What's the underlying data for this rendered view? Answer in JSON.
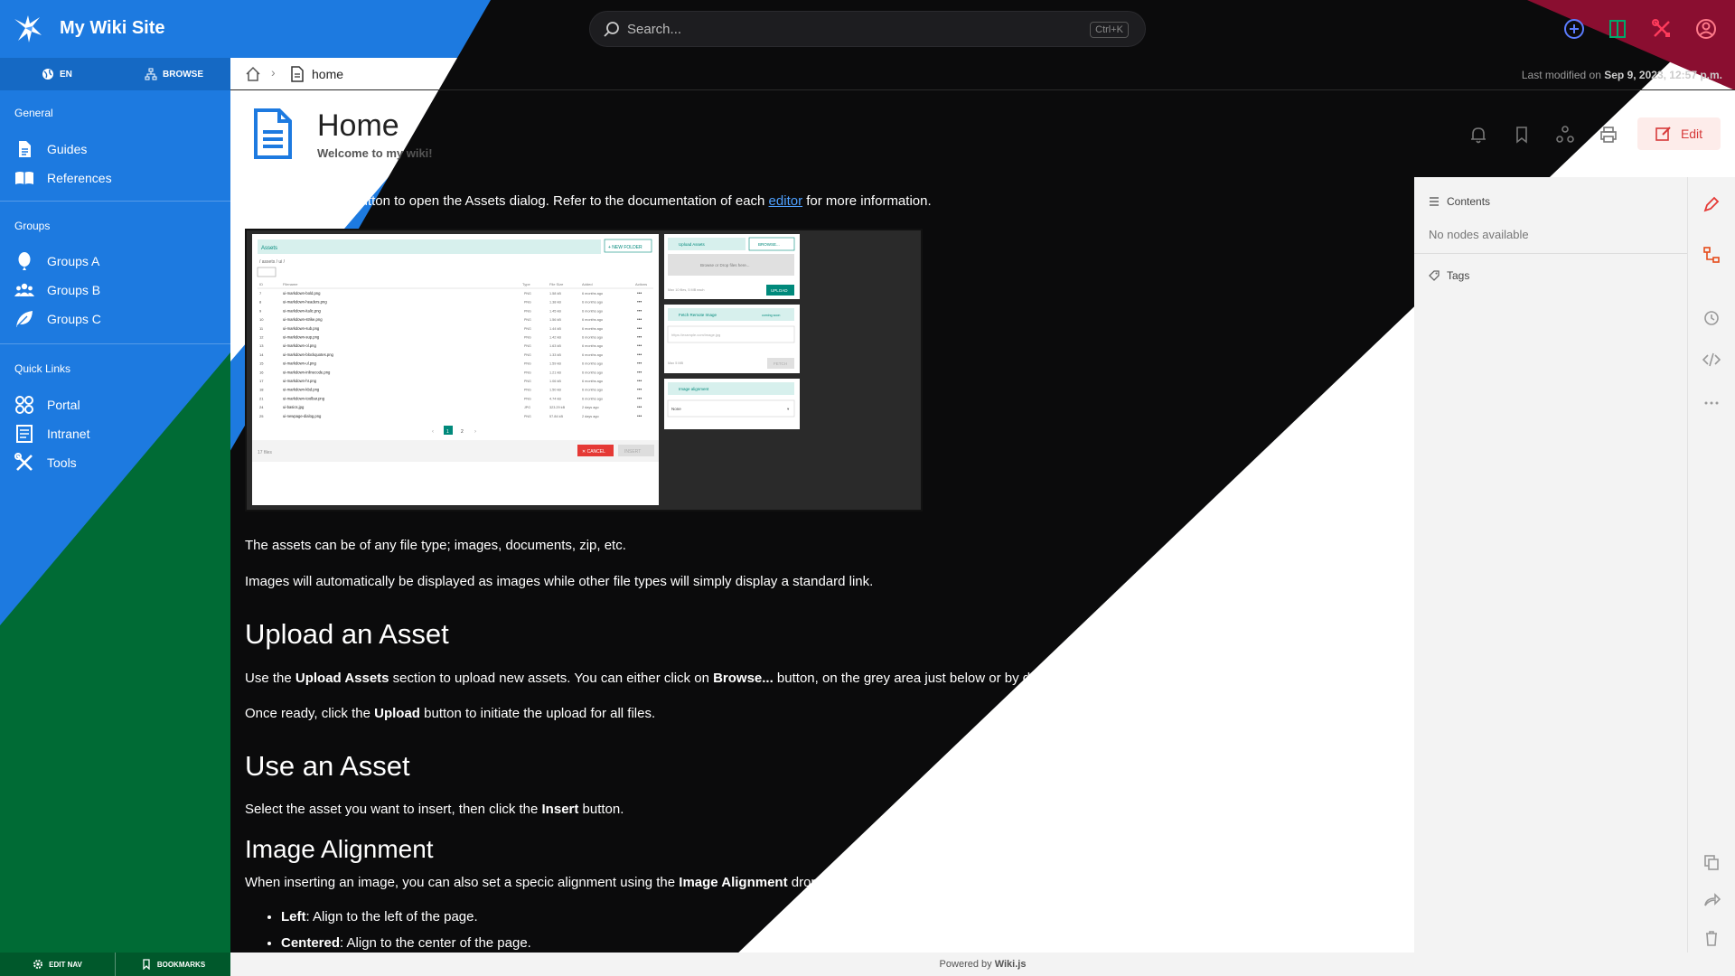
{
  "header": {
    "site_title": "My Wiki Site",
    "search_placeholder": "Search...",
    "search_shortcut": "Ctrl+K",
    "icons": [
      "new-page-icon",
      "browse-icon",
      "admin-icon",
      "account-icon"
    ]
  },
  "sidebar": {
    "tabs": [
      {
        "label": "EN",
        "icon": "globe-icon"
      },
      {
        "label": "BROWSE",
        "icon": "sitemap-icon"
      }
    ],
    "sections": [
      {
        "title": "General",
        "items": [
          {
            "label": "Guides",
            "icon": "document-icon"
          },
          {
            "label": "References",
            "icon": "book-icon"
          }
        ]
      },
      {
        "title": "Groups",
        "items": [
          {
            "label": "Groups A",
            "icon": "balloon-icon"
          },
          {
            "label": "Groups B",
            "icon": "people-icon"
          },
          {
            "label": "Groups C",
            "icon": "leaf-icon"
          }
        ]
      },
      {
        "title": "Quick Links",
        "items": [
          {
            "label": "Portal",
            "icon": "portal-icon"
          },
          {
            "label": "Intranet",
            "icon": "list-icon"
          },
          {
            "label": "Tools",
            "icon": "tools-icon"
          }
        ]
      }
    ],
    "bottom": [
      {
        "label": "EDIT NAV",
        "icon": "gear-icon"
      },
      {
        "label": "BOOKMARKS",
        "icon": "bookmark-icon"
      }
    ]
  },
  "breadcrumb": {
    "current": "home",
    "last_modified_prefix": "Last modified on",
    "last_modified_date": "Sep 9, 2023, 12:57 p.m."
  },
  "page": {
    "title": "Home",
    "subtitle": "Welcome to my wiki!",
    "edit_label": "Edit"
  },
  "content": {
    "intro_before": "All editors have a button to open the Assets dialog. Refer to the documentation of each ",
    "intro_link": "editor",
    "intro_after": " for more information.",
    "p_types": "The assets can be of any file type; images, documents, zip, etc.",
    "p_images": "Images will automatically be displayed as images while other file types will simply display a standard link.",
    "h_upload": "Upload an Asset",
    "upload_1a": "Use the ",
    "upload_1b": "Upload Assets",
    "upload_1c": " section to upload new assets. You can either click on ",
    "upload_1d": "Browse...",
    "upload_1e": " button, on the grey area just below or by drag-n-drop files onto the grey area directly.",
    "upload_2a": "Once ready, click the ",
    "upload_2b": "Upload",
    "upload_2c": " button to initiate the upload for all files.",
    "h_use": "Use an Asset",
    "use_a": "Select the asset you want to insert, then click the ",
    "use_b": "Insert",
    "use_c": " button.",
    "h_align": "Image Alignment",
    "align_a": "When inserting an image, you can also set a specic alignment using the ",
    "align_b": "Image Alignment",
    "align_c": " dropdown menu (to the right of dialog).",
    "list": [
      {
        "term": "Left",
        "desc": ": Align to the left of the page."
      },
      {
        "term": "Centered",
        "desc": ": Align to the center of the page."
      }
    ]
  },
  "asset_dialog": {
    "title": "Assets",
    "new_folder": "NEW FOLDER",
    "path": "/ assets / ui /",
    "columns": [
      "ID",
      "Filename",
      "Type",
      "File Size",
      "Added",
      "Actions"
    ],
    "rows": [
      [
        "7",
        "ui-markdown-bold.png",
        "PNG",
        "1.58 kB",
        "6 months ago"
      ],
      [
        "8",
        "ui-markdown-headers.png",
        "PNG",
        "1.38 kB",
        "6 months ago"
      ],
      [
        "9",
        "ui-markdown-italic.png",
        "PNG",
        "1.45 kB",
        "6 months ago"
      ],
      [
        "10",
        "ui-markdown-strike.png",
        "PNG",
        "1.56 kB",
        "6 months ago"
      ],
      [
        "11",
        "ui-markdown-sub.png",
        "PNG",
        "1.44 kB",
        "6 months ago"
      ],
      [
        "12",
        "ui-markdown-sup.png",
        "PNG",
        "1.42 kB",
        "6 months ago"
      ],
      [
        "13",
        "ui-markdown-ol.png",
        "PNG",
        "1.63 kB",
        "6 months ago"
      ],
      [
        "14",
        "ui-markdown-blockquotes.png",
        "PNG",
        "1.33 kB",
        "6 months ago"
      ],
      [
        "15",
        "ui-markdown-ul.png",
        "PNG",
        "1.59 kB",
        "6 months ago"
      ],
      [
        "16",
        "ui-markdown-inlinecode.png",
        "PNG",
        "1.21 kB",
        "6 months ago"
      ],
      [
        "17",
        "ui-markdown-hr.png",
        "PNG",
        "1.06 kB",
        "6 months ago"
      ],
      [
        "18",
        "ui-markdown-kbd.png",
        "PNG",
        "1.50 kB",
        "6 months ago"
      ],
      [
        "21",
        "ui-markdown-toolbar.png",
        "PNG",
        "4.74 kB",
        "6 months ago"
      ],
      [
        "24",
        "ui-basics.jpg",
        "JPG",
        "323.29 kB",
        "2 days ago"
      ],
      [
        "25",
        "ui-newpage-dialog.png",
        "PNG",
        "57.84 kB",
        "2 days ago"
      ]
    ],
    "files_count": "17 files",
    "cancel": "CANCEL",
    "insert": "INSERT",
    "upload_title": "Upload Assets",
    "browse": "BROWSE...",
    "drop_text": "Browse or Drop files here...",
    "upload_note": "Max 10 files, 5 MB each",
    "upload": "UPLOAD",
    "fetch_title": "Fetch Remote Image",
    "coming_soon": "coming soon",
    "fetch_placeholder": "https://example.com/image.jpg",
    "fetch_note": "Max 5 MB",
    "fetch": "FETCH",
    "align_title": "Image alignment",
    "align_value": "None",
    "pages": [
      "1",
      "2"
    ]
  },
  "toc": {
    "contents_label": "Contents",
    "empty": "No nodes available",
    "tags_label": "Tags"
  },
  "rail": [
    "pen-icon",
    "tree-icon",
    "history-icon",
    "code-icon",
    "more-icon",
    "copy-icon",
    "share-icon",
    "delete-icon"
  ],
  "footer": {
    "prefix": "Powered by ",
    "brand": "Wiki.js"
  },
  "colors": {
    "sidebar": "#1d7ae0",
    "dark": "#0b0b0c",
    "accent_red": "#8a0e30",
    "green": "#006b35",
    "teal": "#00897b",
    "edit": "#d63a3a"
  }
}
